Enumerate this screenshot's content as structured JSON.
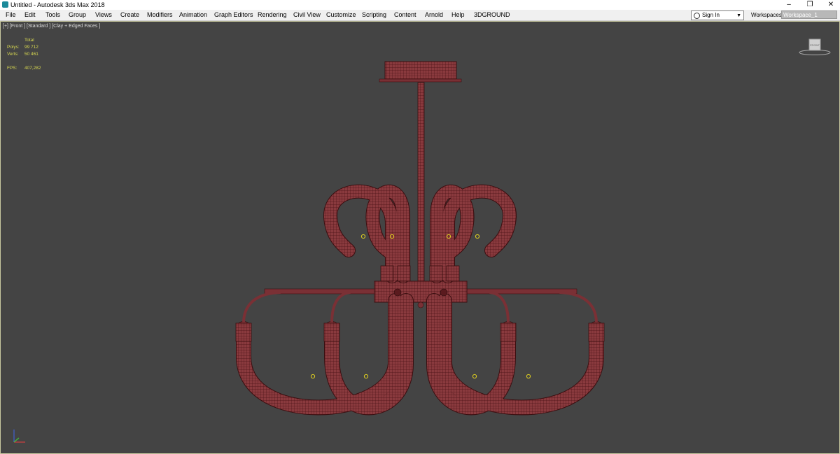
{
  "window": {
    "title": "Untitled - Autodesk 3ds Max 2018"
  },
  "menu": [
    "File",
    "Edit",
    "Tools",
    "Group",
    "Views",
    "Create",
    "Modifiers",
    "Animation",
    "Graph Editors",
    "Rendering",
    "Civil View",
    "Customize",
    "Scripting",
    "Content",
    "Arnold",
    "Help",
    "3DGROUND"
  ],
  "account": {
    "signin_label": "Sign In"
  },
  "workspaces": {
    "label": "Workspaces:",
    "value": "Workspace_1"
  },
  "viewport": {
    "label": "[+] [Front ] [Standard ] [Clay + Edged Faces ]",
    "stats": {
      "total_label": "Total",
      "polys_label": "Polys:",
      "polys_value": "99 712",
      "verts_label": "Verts:",
      "verts_value": "50 461",
      "fps_label": "FPS:",
      "fps_value": "407,282"
    },
    "colors": {
      "background": "#444444",
      "mesh": "#8a3a3e",
      "wire": "#4a1216",
      "stats_text": "#d8d850",
      "pivot": "#e0d020"
    },
    "viewcube_label": "FRONT"
  },
  "icons": {
    "app": "3ds-max-app-icon",
    "user": "user-icon",
    "axis": "axis-tripod-icon"
  }
}
